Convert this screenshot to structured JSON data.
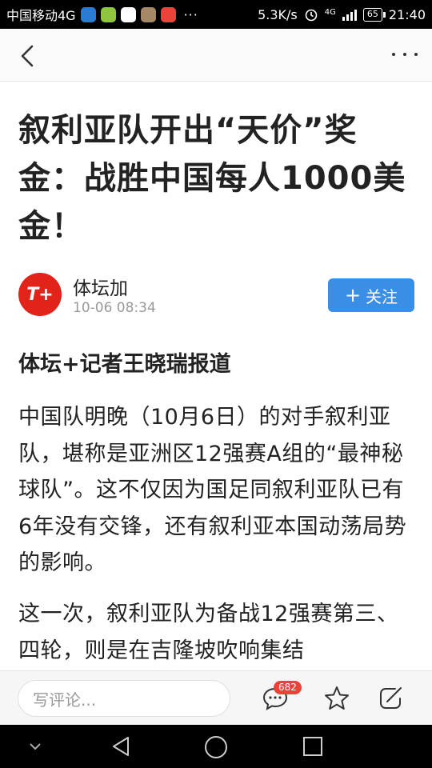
{
  "status_bar": {
    "carrier": "中国移动4G",
    "speed": "5.3K/s",
    "network": "4G",
    "battery": "65",
    "time": "21:40",
    "more": "···"
  },
  "nav": {
    "back_icon": "chevron-left-icon",
    "more_icon": "more-horizontal-icon"
  },
  "article": {
    "title": "叙利亚队开出“天价”奖金：战胜中国每人1000美金！",
    "author": {
      "name": "体坛加",
      "time": "10-06 08:34",
      "avatar_text": "T+",
      "follow_plus": "+",
      "follow_label": "关注"
    },
    "subheading": "体坛+记者王晓瑞报道",
    "paragraphs": [
      "中国队明晚（10月6日）的对手叙利亚队，堪称是亚洲区12强赛A组的“最神秘球队”。这不仅因为国足同叙利亚队已有6年没有交锋，还有叙利亚本国动荡局势的影响。",
      "这一次，叙利亚队为备战12强赛第三、四轮，则是在吉隆坡吹响集结"
    ]
  },
  "bottom_bar": {
    "comment_placeholder": "写评论...",
    "comment_count": "682",
    "icons": [
      "comment-icon",
      "star-icon",
      "share-icon"
    ]
  },
  "colors": {
    "accent": "#3a8ee6",
    "brand_red": "#e2231a",
    "badge": "#e8443a"
  }
}
